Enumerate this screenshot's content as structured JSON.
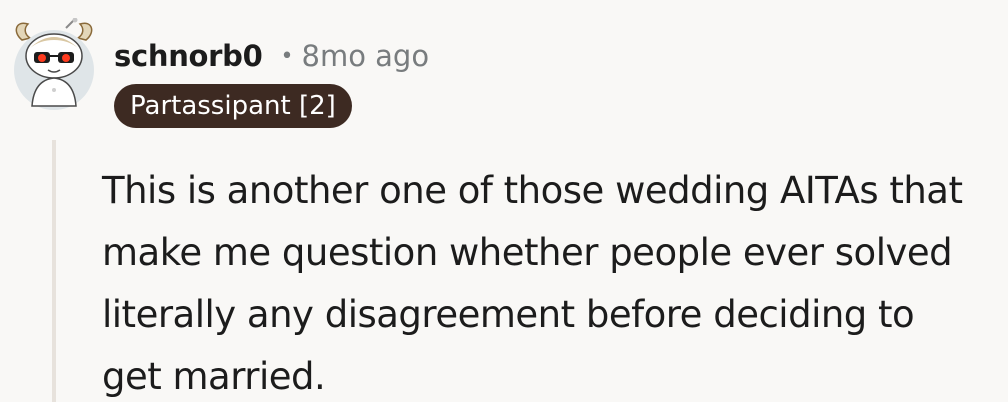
{
  "comment": {
    "username": "schnorb0",
    "separator": "•",
    "timestamp": "8mo ago",
    "flair": "Partassipant [2]",
    "body_lines": [
      "This is another one of those wedding AITAs that",
      "make me question whether people ever solved",
      "literally any disagreement before deciding to",
      "get married."
    ]
  },
  "colors": {
    "background": "#f9f8f6",
    "flair_background": "#3d2a22",
    "flair_text": "#ffffff",
    "meta_text": "#787c7e",
    "thread_line": "#e7e2dc"
  },
  "icons": {
    "avatar": "snoo-avatar-with-red-sunglasses-and-horns"
  }
}
